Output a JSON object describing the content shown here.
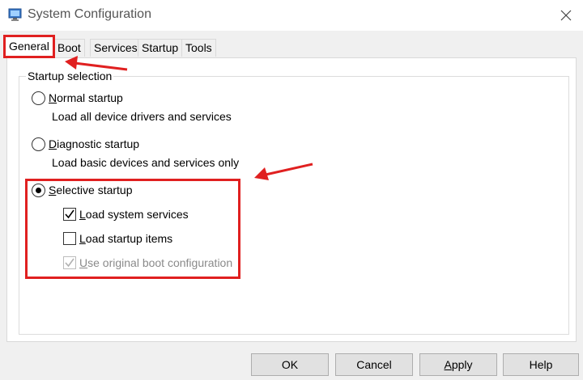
{
  "window": {
    "title": "System Configuration",
    "icon": "system-configuration-icon",
    "close_icon": "close-icon"
  },
  "tabs": [
    {
      "label": "General",
      "active": true
    },
    {
      "label": "Boot",
      "active": false
    },
    {
      "label": "Services",
      "active": false
    },
    {
      "label": "Startup",
      "active": false
    },
    {
      "label": "Tools",
      "active": false
    }
  ],
  "startup_selection": {
    "group_title": "Startup selection",
    "options": [
      {
        "label_first": "N",
        "label_rest": "ormal startup",
        "description": "Load all device drivers and services",
        "selected": false
      },
      {
        "label_first": "D",
        "label_rest": "iagnostic startup",
        "description": "Load basic devices and services only",
        "selected": false
      },
      {
        "label_first": "S",
        "label_rest": "elective startup",
        "selected": true
      }
    ],
    "selective_items": [
      {
        "label_first": "L",
        "label_rest": "oad system services",
        "checked": true,
        "enabled": true
      },
      {
        "label_first": "L",
        "label_rest": "oad startup items",
        "checked": false,
        "enabled": true
      },
      {
        "label_first": "U",
        "label_rest": "se original boot configuration",
        "checked": true,
        "enabled": false
      }
    ]
  },
  "buttons": {
    "ok": "OK",
    "cancel": "Cancel",
    "apply_first": "A",
    "apply_rest": "pply",
    "help": "Help"
  },
  "colors": {
    "annotation_red": "#e02020",
    "window_bg": "#f0f0f0",
    "button_bg": "#e1e1e1"
  }
}
